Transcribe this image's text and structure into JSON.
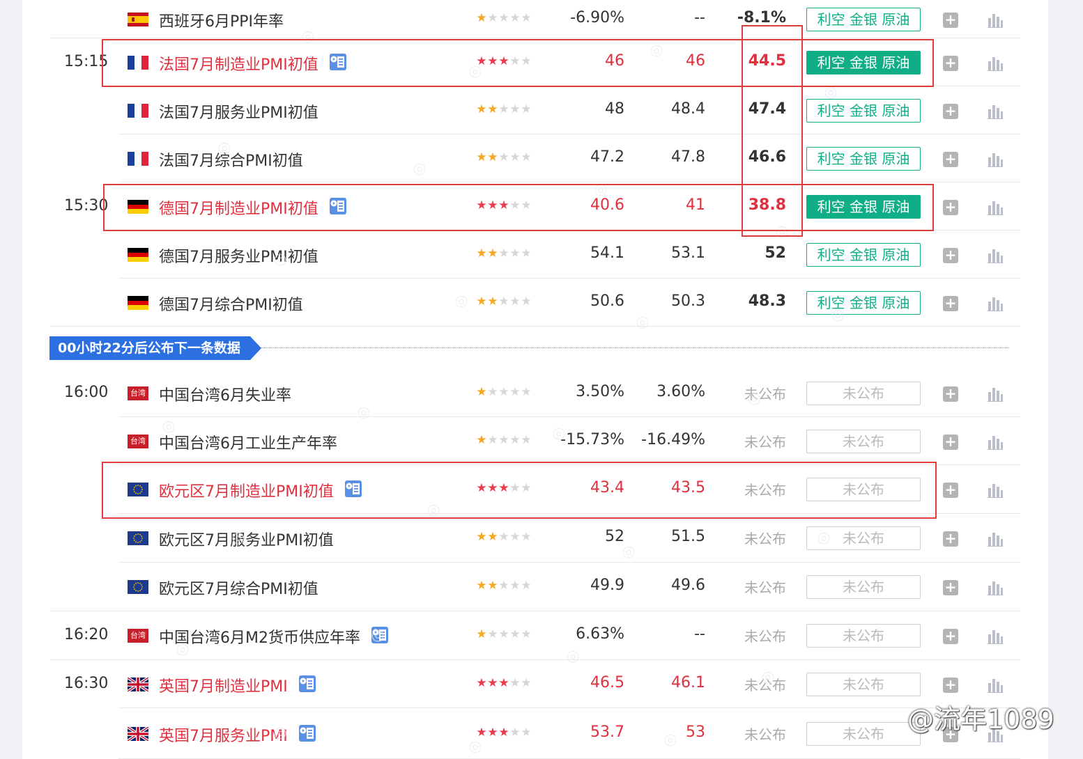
{
  "countdown_banner": "00小时22分后公布下一条数据",
  "impact_text": "利空 金银 原油",
  "pending_text": "未公布",
  "watermark": "@流年1089",
  "colors": {
    "highlight_red": "#e0303e",
    "impact_green": "#0fae86",
    "banner_blue": "#2b6fe0",
    "star_gold": "#f5a623",
    "star_red": "#e83c4b",
    "star_empty": "#d6d6d6"
  },
  "rows": [
    {
      "time": "",
      "flag": "spain-flag",
      "name": "西班牙6月PPI年率",
      "stars": 1,
      "prev": "-6.90%",
      "forecast": "--",
      "actual": "-8.1%",
      "impact": "利空 金银 原油",
      "status": "released",
      "highlight": false,
      "news": false
    },
    {
      "time": "15:15",
      "flag": "france-flag",
      "name": "法国7月制造业PMI初值",
      "stars": 3,
      "prev": "46",
      "forecast": "46",
      "actual": "44.5",
      "impact": "利空 金银 原油",
      "status": "released",
      "highlight": true,
      "news": true
    },
    {
      "time": "",
      "flag": "france-flag",
      "name": "法国7月服务业PMI初值",
      "stars": 2,
      "prev": "48",
      "forecast": "48.4",
      "actual": "47.4",
      "impact": "利空 金银 原油",
      "status": "released",
      "highlight": false,
      "news": false
    },
    {
      "time": "",
      "flag": "france-flag",
      "name": "法国7月综合PMI初值",
      "stars": 2,
      "prev": "47.2",
      "forecast": "47.8",
      "actual": "46.6",
      "impact": "利空 金银 原油",
      "status": "released",
      "highlight": false,
      "news": false
    },
    {
      "time": "15:30",
      "flag": "germany-flag",
      "name": "德国7月制造业PMI初值",
      "stars": 3,
      "prev": "40.6",
      "forecast": "41",
      "actual": "38.8",
      "impact": "利空 金银 原油",
      "status": "released",
      "highlight": true,
      "news": true
    },
    {
      "time": "",
      "flag": "germany-flag",
      "name": "德国7月服务业PMI初值",
      "stars": 2,
      "prev": "54.1",
      "forecast": "53.1",
      "actual": "52",
      "impact": "利空 金银 原油",
      "status": "released",
      "highlight": false,
      "news": false
    },
    {
      "time": "",
      "flag": "germany-flag",
      "name": "德国7月综合PMI初值",
      "stars": 2,
      "prev": "50.6",
      "forecast": "50.3",
      "actual": "48.3",
      "impact": "利空 金银 原油",
      "status": "released",
      "highlight": false,
      "news": false
    },
    {
      "time": "16:00",
      "flag": "taiwan-flag",
      "flag_text": "台湾",
      "name": "中国台湾6月失业率",
      "stars": 1,
      "prev": "3.50%",
      "forecast": "3.60%",
      "actual": "未公布",
      "impact": "未公布",
      "status": "pending",
      "highlight": false,
      "news": false
    },
    {
      "time": "",
      "flag": "taiwan-flag",
      "flag_text": "台湾",
      "name": "中国台湾6月工业生产年率",
      "stars": 1,
      "prev": "-15.73%",
      "forecast": "-16.49%",
      "actual": "未公布",
      "impact": "未公布",
      "status": "pending",
      "highlight": false,
      "news": false
    },
    {
      "time": "",
      "flag": "eu-flag",
      "name": "欧元区7月制造业PMI初值",
      "stars": 3,
      "prev": "43.4",
      "forecast": "43.5",
      "actual": "未公布",
      "impact": "未公布",
      "status": "pending",
      "highlight": true,
      "news": true
    },
    {
      "time": "",
      "flag": "eu-flag",
      "name": "欧元区7月服务业PMI初值",
      "stars": 2,
      "prev": "52",
      "forecast": "51.5",
      "actual": "未公布",
      "impact": "未公布",
      "status": "pending",
      "highlight": false,
      "news": false
    },
    {
      "time": "",
      "flag": "eu-flag",
      "name": "欧元区7月综合PMI初值",
      "stars": 2,
      "prev": "49.9",
      "forecast": "49.6",
      "actual": "未公布",
      "impact": "未公布",
      "status": "pending",
      "highlight": false,
      "news": false
    },
    {
      "time": "16:20",
      "flag": "taiwan-flag",
      "flag_text": "台湾",
      "name": "中国台湾6月M2货币供应年率",
      "stars": 1,
      "prev": "6.63%",
      "forecast": "--",
      "actual": "未公布",
      "impact": "未公布",
      "status": "pending",
      "highlight": false,
      "news": true
    },
    {
      "time": "16:30",
      "flag": "uk-flag",
      "name": "英国7月制造业PMI",
      "stars": 3,
      "prev": "46.5",
      "forecast": "46.1",
      "actual": "未公布",
      "impact": "未公布",
      "status": "pending",
      "highlight": true,
      "news": true
    },
    {
      "time": "",
      "flag": "uk-flag",
      "name": "英国7月服务业PMI",
      "stars": 3,
      "prev": "53.7",
      "forecast": "53",
      "actual": "未公布",
      "impact": "未公布",
      "status": "pending",
      "highlight": true,
      "news": true
    }
  ]
}
